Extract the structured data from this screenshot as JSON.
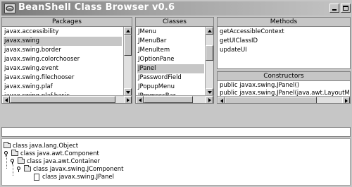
{
  "window": {
    "title": "BeanShell Class Browser v0.6"
  },
  "packages": {
    "header": "Packages",
    "items": [
      "javax.accessibility",
      "javax.swing",
      "javax.swing.border",
      "javax.swing.colorchooser",
      "javax.swing.event",
      "javax.swing.filechooser",
      "javax.swing.plaf",
      "javax.swing.plaf.basic"
    ],
    "selected": "javax.swing"
  },
  "classes": {
    "header": "Classes",
    "items": [
      "JMenu",
      "JMenuBar",
      "JMenuItem",
      "JOptionPane",
      "JPanel",
      "JPasswordField",
      "JPopupMenu",
      "JProgressBar"
    ],
    "selected": "JPanel"
  },
  "methods": {
    "header": "Methods",
    "items": [
      "getAccessibleContext",
      "getUIClassID",
      "updateUI"
    ]
  },
  "constructors": {
    "header": "Constructors",
    "items": [
      "public javax.swing.JPanel()",
      "public javax.swing.JPanel(java.awt.LayoutManager)"
    ]
  },
  "tree": {
    "nodes": [
      {
        "label": "class java.lang.Object",
        "kind": "folder"
      },
      {
        "label": "class java.awt.Component",
        "kind": "folder"
      },
      {
        "label": "class java.awt.Container",
        "kind": "folder"
      },
      {
        "label": "class javax.swing.JComponent",
        "kind": "folder"
      },
      {
        "label": "class javax.swing.JPanel",
        "kind": "leaf"
      }
    ]
  },
  "icons": {
    "window": "bean-icon",
    "minimize": "minimize-icon",
    "maximize": "maximize-icon",
    "tree_folder": "folder-icon",
    "tree_leaf": "file-icon",
    "tree_handle": "tree-expand-handle-icon"
  }
}
